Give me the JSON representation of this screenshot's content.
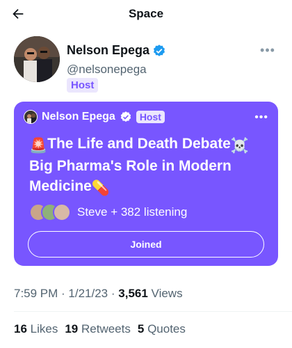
{
  "header": {
    "title": "Space",
    "back_icon": "arrow-left-icon"
  },
  "author": {
    "name": "Nelson Epega",
    "handle": "@nelsonepega",
    "role": "Host",
    "verified_icon": "verified-badge-icon",
    "more_icon": "more-horizontal-icon"
  },
  "space": {
    "host_name": "Nelson Epega",
    "host_role": "Host",
    "more_label": "...",
    "title_part1": "The Life and Death Debate",
    "title_part2": " Big Pharma's Role in Modern Medicine",
    "emoji1": "🚨",
    "emoji2": "☠️",
    "emoji3": "💊",
    "listeners_text": "Steve + 382 listening",
    "joined_label": "Joined",
    "color": "#7856ff"
  },
  "meta": {
    "time": "7:59 PM",
    "sep1": " · ",
    "date": "1/21/23",
    "sep2": " · ",
    "views_count": "3,561",
    "views_label": " Views"
  },
  "stats": {
    "likes_count": "16",
    "likes_label": "Likes",
    "retweets_count": "19",
    "retweets_label": "Retweets",
    "quotes_count": "5",
    "quotes_label": "Quotes"
  }
}
